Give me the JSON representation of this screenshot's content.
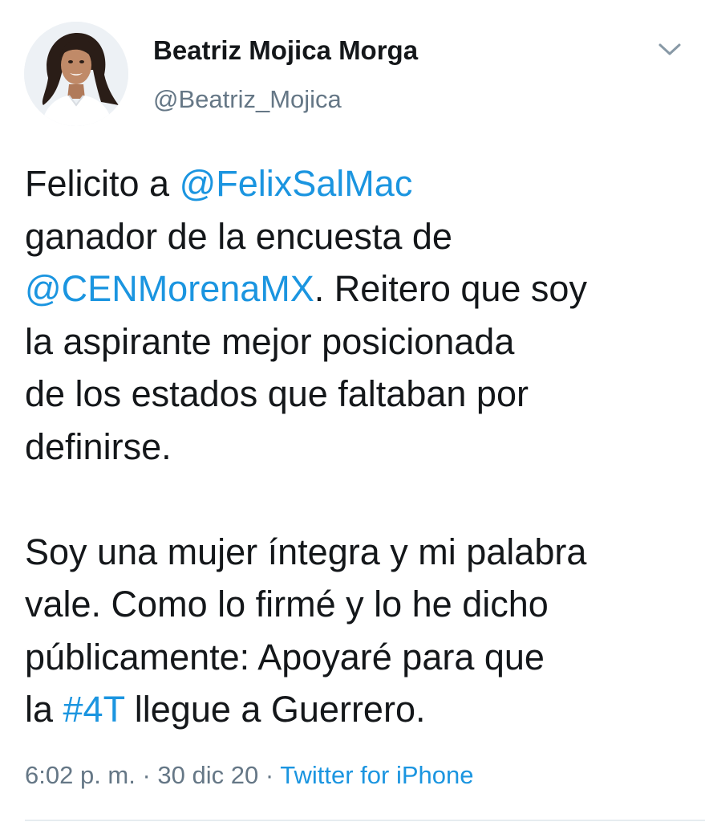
{
  "author": {
    "display_name": "Beatriz Mojica Morga",
    "handle": "@Beatriz_Mojica"
  },
  "tweet": {
    "lines": [
      [
        {
          "text": "Felicito a "
        },
        {
          "text": "@FelixSalMac",
          "link": true
        }
      ],
      [
        {
          "text": "ganador de la encuesta de"
        }
      ],
      [
        {
          "text": "@CENMorenaMX",
          "link": true
        },
        {
          "text": ". Reitero que soy"
        }
      ],
      [
        {
          "text": "la aspirante mejor posicionada"
        }
      ],
      [
        {
          "text": "de los estados que faltaban por"
        }
      ],
      [
        {
          "text": "definirse."
        }
      ],
      [],
      [
        {
          "text": "Soy una mujer íntegra y mi palabra"
        }
      ],
      [
        {
          "text": "vale. Como lo firmé y lo he dicho"
        }
      ],
      [
        {
          "text": "públicamente: Apoyaré para que"
        }
      ],
      [
        {
          "text": "la "
        },
        {
          "text": "#4T",
          "link": true
        },
        {
          "text": " llegue a Guerrero."
        }
      ]
    ]
  },
  "meta": {
    "time": "6:02 p. m.",
    "separator": " · ",
    "date": "30 dic 20",
    "source": "Twitter for iPhone"
  },
  "icons": {
    "caret": "chevron-down-icon",
    "avatar": "profile-photo"
  },
  "colors": {
    "link": "#1b95e0",
    "secondary": "#657786",
    "text": "#14171a"
  }
}
